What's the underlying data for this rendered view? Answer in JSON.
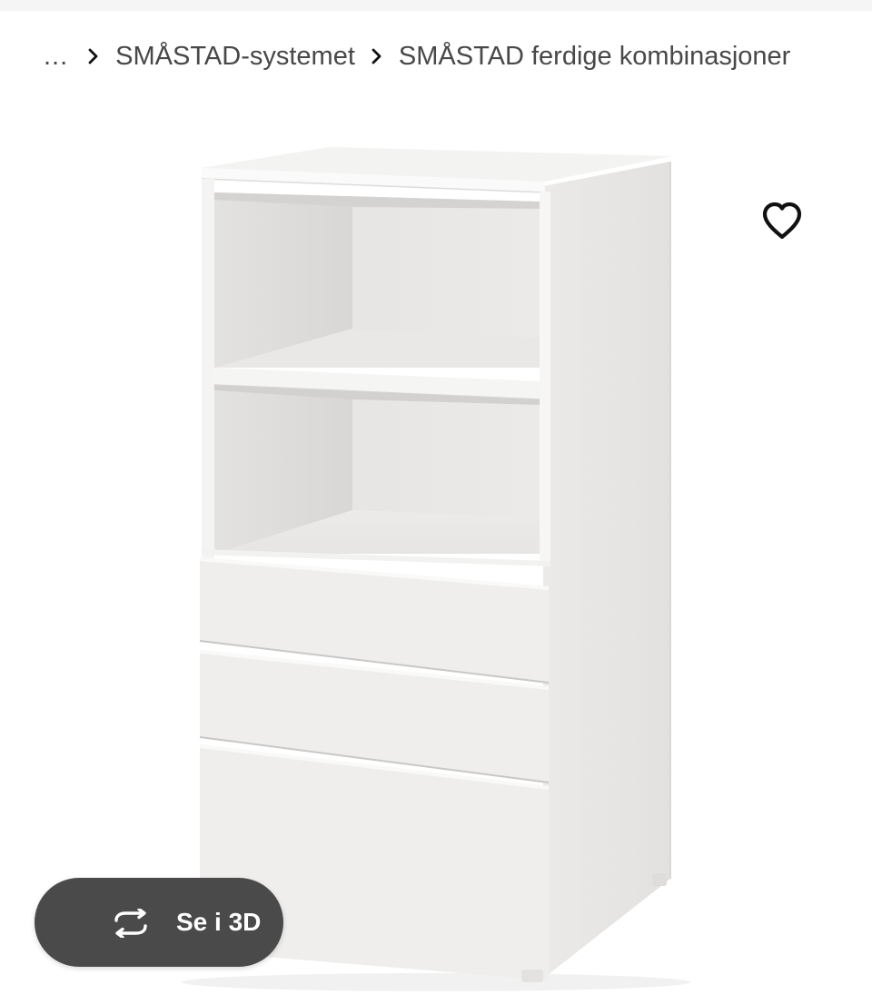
{
  "breadcrumb": {
    "ellipsis": "...",
    "items": [
      {
        "label": "SMÅSTAD-systemet"
      },
      {
        "label": "SMÅSTAD ferdige kombinasjoner"
      }
    ]
  },
  "product": {
    "image_icon": "product-photo"
  },
  "favorite": {
    "icon": "heart-icon"
  },
  "view_3d": {
    "label": "Se i 3D",
    "icon": "rotate-3d-icon"
  },
  "colors": {
    "breadcrumb_text": "#484848",
    "pill_background": "#4a4a4a",
    "pill_text": "#ffffff"
  }
}
